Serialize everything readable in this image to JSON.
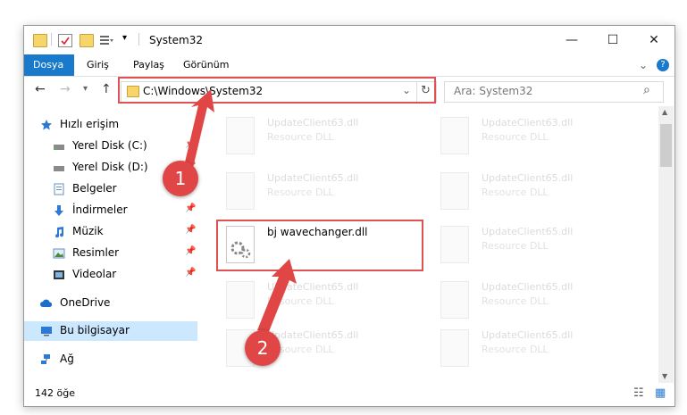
{
  "window": {
    "title": "System32",
    "minimize_glyph": "—",
    "maximize_glyph": "☐",
    "close_glyph": "✕",
    "down_glyph": "▾",
    "help_glyph": "?",
    "expand_glyph": "⌄"
  },
  "ribbon": {
    "tabs": [
      {
        "label": "Dosya",
        "active": true
      },
      {
        "label": "Giriş"
      },
      {
        "label": "Paylaş"
      },
      {
        "label": "Görünüm"
      }
    ]
  },
  "nav": {
    "back_glyph": "←",
    "forward_glyph": "→",
    "recent_glyph": "▾",
    "up_glyph": "↑",
    "address": "C:\\Windows\\System32",
    "address_dropdown_glyph": "⌄",
    "refresh_glyph": "↻",
    "search_placeholder": "Ara: System32",
    "search_glyph": "⌕"
  },
  "sidebar": {
    "items": [
      {
        "label": "Hızlı erişim",
        "icon": "star-icon"
      },
      {
        "label": "Yerel Disk (C:)",
        "icon": "drive-icon"
      },
      {
        "label": "Yerel Disk (D:)",
        "icon": "drive-icon"
      },
      {
        "label": "Belgeler",
        "icon": "documents-icon"
      },
      {
        "label": "İndirmeler",
        "icon": "downloads-icon"
      },
      {
        "label": "Müzik",
        "icon": "music-icon"
      },
      {
        "label": "Resimler",
        "icon": "pictures-icon"
      },
      {
        "label": "Videolar",
        "icon": "videos-icon"
      },
      {
        "label": "OneDrive",
        "icon": "cloud-icon"
      },
      {
        "label": "Bu bilgisayar",
        "icon": "computer-icon"
      },
      {
        "label": "Ağ",
        "icon": "network-icon"
      }
    ],
    "pin_glyph": "📌"
  },
  "files": {
    "left": [
      {
        "name": "UpdateClient63.dll",
        "type": "Resource DLL"
      },
      {
        "name": "UpdateClient65.dll",
        "type": "Resource DLL"
      },
      {
        "name": "bj wavechanger.dll",
        "type": ""
      },
      {
        "name": "UpdateClient65.dll",
        "type": "Resource DLL"
      },
      {
        "name": "UpdateClient65.dll",
        "type": "Resource DLL"
      }
    ],
    "right": [
      {
        "name": "UpdateClient63.dll",
        "type": "Resource DLL"
      },
      {
        "name": "UpdateClient65.dll",
        "type": "Resource DLL"
      },
      {
        "name": "UpdateClient65.dll",
        "type": "Resource DLL"
      },
      {
        "name": "UpdateClient65.dll",
        "type": "Resource DLL"
      },
      {
        "name": "UpdateClient65.dll",
        "type": "Resource DLL"
      }
    ]
  },
  "status": {
    "count": "142 öğe",
    "details_view_glyph": "☷",
    "tiles_view_glyph": "▦"
  },
  "annotations": {
    "marker1": "1",
    "marker2": "2"
  },
  "colors": {
    "accent": "#1979ca",
    "annotation_red": "#e04646",
    "selection": "#cce8ff"
  }
}
